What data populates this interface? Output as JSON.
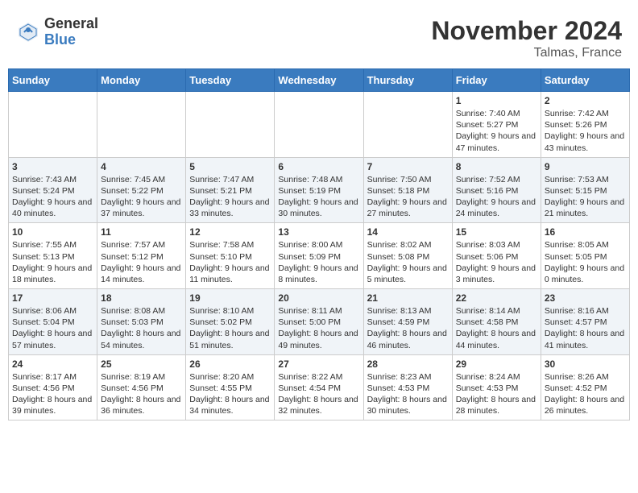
{
  "header": {
    "logo_general": "General",
    "logo_blue": "Blue",
    "month_year": "November 2024",
    "location": "Talmas, France"
  },
  "days_of_week": [
    "Sunday",
    "Monday",
    "Tuesday",
    "Wednesday",
    "Thursday",
    "Friday",
    "Saturday"
  ],
  "weeks": [
    [
      {
        "day": "",
        "sunrise": "",
        "sunset": "",
        "daylight": ""
      },
      {
        "day": "",
        "sunrise": "",
        "sunset": "",
        "daylight": ""
      },
      {
        "day": "",
        "sunrise": "",
        "sunset": "",
        "daylight": ""
      },
      {
        "day": "",
        "sunrise": "",
        "sunset": "",
        "daylight": ""
      },
      {
        "day": "",
        "sunrise": "",
        "sunset": "",
        "daylight": ""
      },
      {
        "day": "1",
        "sunrise": "Sunrise: 7:40 AM",
        "sunset": "Sunset: 5:27 PM",
        "daylight": "Daylight: 9 hours and 47 minutes."
      },
      {
        "day": "2",
        "sunrise": "Sunrise: 7:42 AM",
        "sunset": "Sunset: 5:26 PM",
        "daylight": "Daylight: 9 hours and 43 minutes."
      }
    ],
    [
      {
        "day": "3",
        "sunrise": "Sunrise: 7:43 AM",
        "sunset": "Sunset: 5:24 PM",
        "daylight": "Daylight: 9 hours and 40 minutes."
      },
      {
        "day": "4",
        "sunrise": "Sunrise: 7:45 AM",
        "sunset": "Sunset: 5:22 PM",
        "daylight": "Daylight: 9 hours and 37 minutes."
      },
      {
        "day": "5",
        "sunrise": "Sunrise: 7:47 AM",
        "sunset": "Sunset: 5:21 PM",
        "daylight": "Daylight: 9 hours and 33 minutes."
      },
      {
        "day": "6",
        "sunrise": "Sunrise: 7:48 AM",
        "sunset": "Sunset: 5:19 PM",
        "daylight": "Daylight: 9 hours and 30 minutes."
      },
      {
        "day": "7",
        "sunrise": "Sunrise: 7:50 AM",
        "sunset": "Sunset: 5:18 PM",
        "daylight": "Daylight: 9 hours and 27 minutes."
      },
      {
        "day": "8",
        "sunrise": "Sunrise: 7:52 AM",
        "sunset": "Sunset: 5:16 PM",
        "daylight": "Daylight: 9 hours and 24 minutes."
      },
      {
        "day": "9",
        "sunrise": "Sunrise: 7:53 AM",
        "sunset": "Sunset: 5:15 PM",
        "daylight": "Daylight: 9 hours and 21 minutes."
      }
    ],
    [
      {
        "day": "10",
        "sunrise": "Sunrise: 7:55 AM",
        "sunset": "Sunset: 5:13 PM",
        "daylight": "Daylight: 9 hours and 18 minutes."
      },
      {
        "day": "11",
        "sunrise": "Sunrise: 7:57 AM",
        "sunset": "Sunset: 5:12 PM",
        "daylight": "Daylight: 9 hours and 14 minutes."
      },
      {
        "day": "12",
        "sunrise": "Sunrise: 7:58 AM",
        "sunset": "Sunset: 5:10 PM",
        "daylight": "Daylight: 9 hours and 11 minutes."
      },
      {
        "day": "13",
        "sunrise": "Sunrise: 8:00 AM",
        "sunset": "Sunset: 5:09 PM",
        "daylight": "Daylight: 9 hours and 8 minutes."
      },
      {
        "day": "14",
        "sunrise": "Sunrise: 8:02 AM",
        "sunset": "Sunset: 5:08 PM",
        "daylight": "Daylight: 9 hours and 5 minutes."
      },
      {
        "day": "15",
        "sunrise": "Sunrise: 8:03 AM",
        "sunset": "Sunset: 5:06 PM",
        "daylight": "Daylight: 9 hours and 3 minutes."
      },
      {
        "day": "16",
        "sunrise": "Sunrise: 8:05 AM",
        "sunset": "Sunset: 5:05 PM",
        "daylight": "Daylight: 9 hours and 0 minutes."
      }
    ],
    [
      {
        "day": "17",
        "sunrise": "Sunrise: 8:06 AM",
        "sunset": "Sunset: 5:04 PM",
        "daylight": "Daylight: 8 hours and 57 minutes."
      },
      {
        "day": "18",
        "sunrise": "Sunrise: 8:08 AM",
        "sunset": "Sunset: 5:03 PM",
        "daylight": "Daylight: 8 hours and 54 minutes."
      },
      {
        "day": "19",
        "sunrise": "Sunrise: 8:10 AM",
        "sunset": "Sunset: 5:02 PM",
        "daylight": "Daylight: 8 hours and 51 minutes."
      },
      {
        "day": "20",
        "sunrise": "Sunrise: 8:11 AM",
        "sunset": "Sunset: 5:00 PM",
        "daylight": "Daylight: 8 hours and 49 minutes."
      },
      {
        "day": "21",
        "sunrise": "Sunrise: 8:13 AM",
        "sunset": "Sunset: 4:59 PM",
        "daylight": "Daylight: 8 hours and 46 minutes."
      },
      {
        "day": "22",
        "sunrise": "Sunrise: 8:14 AM",
        "sunset": "Sunset: 4:58 PM",
        "daylight": "Daylight: 8 hours and 44 minutes."
      },
      {
        "day": "23",
        "sunrise": "Sunrise: 8:16 AM",
        "sunset": "Sunset: 4:57 PM",
        "daylight": "Daylight: 8 hours and 41 minutes."
      }
    ],
    [
      {
        "day": "24",
        "sunrise": "Sunrise: 8:17 AM",
        "sunset": "Sunset: 4:56 PM",
        "daylight": "Daylight: 8 hours and 39 minutes."
      },
      {
        "day": "25",
        "sunrise": "Sunrise: 8:19 AM",
        "sunset": "Sunset: 4:56 PM",
        "daylight": "Daylight: 8 hours and 36 minutes."
      },
      {
        "day": "26",
        "sunrise": "Sunrise: 8:20 AM",
        "sunset": "Sunset: 4:55 PM",
        "daylight": "Daylight: 8 hours and 34 minutes."
      },
      {
        "day": "27",
        "sunrise": "Sunrise: 8:22 AM",
        "sunset": "Sunset: 4:54 PM",
        "daylight": "Daylight: 8 hours and 32 minutes."
      },
      {
        "day": "28",
        "sunrise": "Sunrise: 8:23 AM",
        "sunset": "Sunset: 4:53 PM",
        "daylight": "Daylight: 8 hours and 30 minutes."
      },
      {
        "day": "29",
        "sunrise": "Sunrise: 8:24 AM",
        "sunset": "Sunset: 4:53 PM",
        "daylight": "Daylight: 8 hours and 28 minutes."
      },
      {
        "day": "30",
        "sunrise": "Sunrise: 8:26 AM",
        "sunset": "Sunset: 4:52 PM",
        "daylight": "Daylight: 8 hours and 26 minutes."
      }
    ]
  ]
}
